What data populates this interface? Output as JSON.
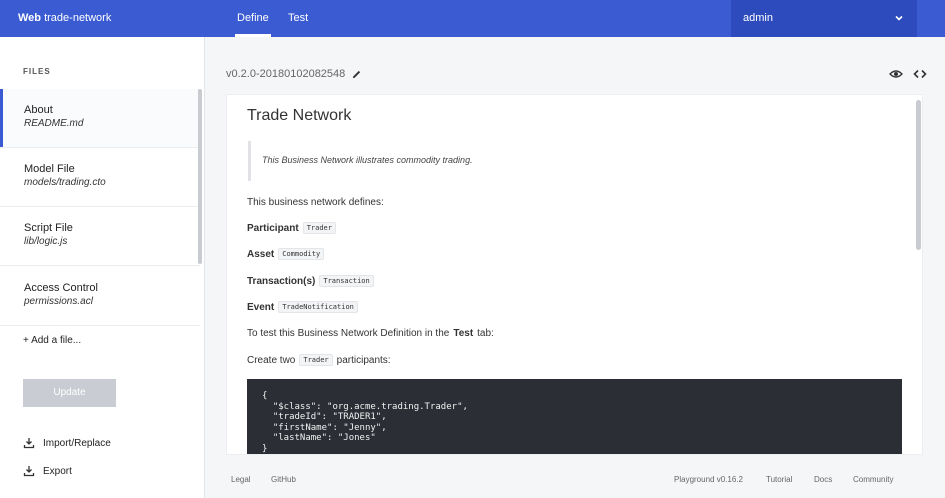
{
  "topbar": {
    "brand_bold": "Web",
    "brand_name": " trade-network",
    "tabs": [
      {
        "label": "Define",
        "active": true
      },
      {
        "label": "Test",
        "active": false
      }
    ],
    "user": "admin",
    "color": "#3b5bd2"
  },
  "sidebar": {
    "header": "FILES",
    "files": [
      {
        "name": "About",
        "path": "README.md",
        "active": true
      },
      {
        "name": "Model File",
        "path": "models/trading.cto",
        "active": false
      },
      {
        "name": "Script File",
        "path": "lib/logic.js",
        "active": false
      },
      {
        "name": "Access Control",
        "path": "permissions.acl",
        "active": false
      }
    ],
    "add_file": "+ Add a file...",
    "update_label": "Update",
    "import_label": "Import/Replace",
    "export_label": "Export"
  },
  "main": {
    "version": "v0.2.0-20180102082548",
    "doc": {
      "title": "Trade Network",
      "quote": "This Business Network illustrates commodity trading.",
      "intro": "This business network defines:",
      "participant_label": "Participant",
      "participant_code": "Trader",
      "asset_label": "Asset",
      "asset_code": "Commodity",
      "transaction_label": "Transaction(s)",
      "transaction_code": "Transaction",
      "event_label": "Event",
      "event_code": "TradeNotification",
      "test_pre": "To test this Business Network Definition in the",
      "test_bold": "Test",
      "test_post": "tab:",
      "create_pre": "Create two",
      "create_code": "Trader",
      "create_post": "participants:",
      "code": "{\n  \"$class\": \"org.acme.trading.Trader\",\n  \"tradeId\": \"TRADER1\",\n  \"firstName\": \"Jenny\",\n  \"lastName\": \"Jones\"\n}"
    }
  },
  "footer": {
    "legal": "Legal",
    "github": "GitHub",
    "playground": "Playground v0.16.2",
    "tutorial": "Tutorial",
    "docs": "Docs",
    "community": "Community"
  }
}
